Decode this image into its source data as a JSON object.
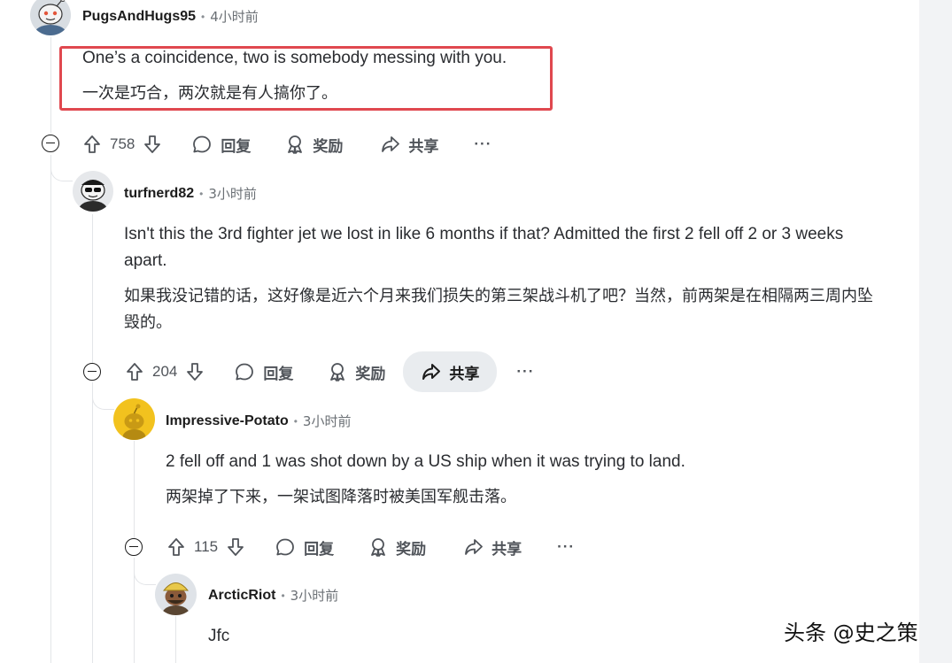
{
  "comments": [
    {
      "author": "PugsAndHugs95",
      "time": "4小时前",
      "en": "One’s a coincidence, two is somebody messing with you.",
      "zh": "一次是巧合，两次就是有人搞你了。",
      "votes": "758",
      "reply_label": "回复",
      "award_label": "奖励",
      "share_label": "共享",
      "more_label": "···"
    },
    {
      "author": "turfnerd82",
      "time": "3小时前",
      "en": "Isn't this the 3rd fighter jet we lost in like 6 months if that? Admitted the first 2 fell off 2 or 3 weeks apart.",
      "zh": "如果我没记错的话，这好像是近六个月来我们损失的第三架战斗机了吧？当然，前两架是在相隔两三周内坠毁的。",
      "votes": "204",
      "reply_label": "回复",
      "award_label": "奖励",
      "share_label": "共享",
      "more_label": "···"
    },
    {
      "author": "Impressive-Potato",
      "time": "3小时前",
      "en": "2 fell off and 1 was shot down by a US ship when it was trying to land.",
      "zh": "两架掉了下来，一架试图降落时被美国军舰击落。",
      "votes": "115",
      "reply_label": "回复",
      "award_label": "奖励",
      "share_label": "共享",
      "more_label": "···"
    },
    {
      "author": "ArcticRiot",
      "time": "3小时前",
      "en": "Jfc"
    }
  ],
  "separator": "•",
  "watermark": "头条 @史之策",
  "colors": {
    "highlight": "#e0484f",
    "thread_line": "#e3e5e8",
    "potato_avatar": "#f2c21e"
  }
}
